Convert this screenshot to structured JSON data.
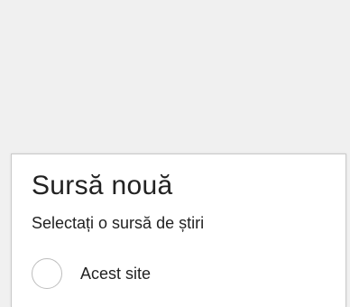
{
  "dialog": {
    "title": "Sursă nouă",
    "subtitle": "Selectați o sursă de știri",
    "options": [
      {
        "label": "Acest site",
        "selected": false
      }
    ]
  },
  "colors": {
    "page_background": "#f0f0f0",
    "panel_background": "#ffffff",
    "panel_border": "#c9c9c9",
    "text": "#222222",
    "radio_border": "#bdbdbd"
  }
}
